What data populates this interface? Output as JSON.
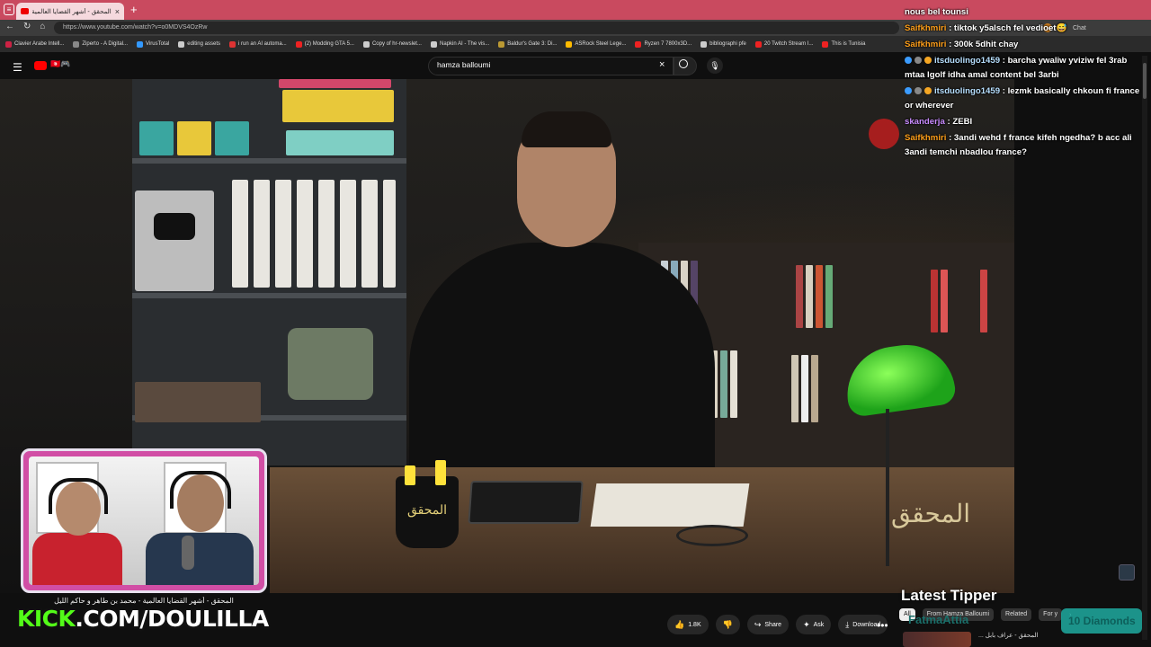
{
  "browser": {
    "tab_title": "المحقق - أشهر القضايا العالمية - مد",
    "tab_close": "×",
    "new_tab": "+",
    "url": "https://www.youtube.com/watch?v=o0MDVS4OzRw",
    "bookmarks": [
      {
        "label": "Clavier Arabe Intell...",
        "color": "#c24"
      },
      {
        "label": "Ziperto - A Digital...",
        "color": "#888"
      },
      {
        "label": "VirusTotal",
        "color": "#39f"
      },
      {
        "label": "editing assets",
        "color": "#ccc"
      },
      {
        "label": "i run an AI automa...",
        "color": "#d33"
      },
      {
        "label": "(2) Modding GTA 5...",
        "color": "#e22"
      },
      {
        "label": "Copy of hr-newslet...",
        "color": "#ccc"
      },
      {
        "label": "Napkin AI - The vis...",
        "color": "#ccc"
      },
      {
        "label": "Baldur's Gate 3: Di...",
        "color": "#b93"
      },
      {
        "label": "ASRock Steel Lege...",
        "color": "#fb0"
      },
      {
        "label": "Ryzen 7 7800x3D...",
        "color": "#e22"
      },
      {
        "label": "bibliographi pfe",
        "color": "#ccc"
      },
      {
        "label": "20 Twitch Stream I...",
        "color": "#e22"
      },
      {
        "label": "This is Tunisia",
        "color": "#e22"
      }
    ]
  },
  "youtube": {
    "search_query": "hamza balloumi",
    "search_clear": "×",
    "logo_extra": "🇹🇳🎮",
    "actions": [
      {
        "icon": "👍",
        "label": "1.8K",
        "name": "like-button"
      },
      {
        "icon": "👎",
        "label": "",
        "name": "dislike-button"
      },
      {
        "icon": "↪",
        "label": "Share",
        "name": "share-button"
      },
      {
        "icon": "✦",
        "label": "Ask",
        "name": "ask-button"
      },
      {
        "icon": "⤓",
        "label": "Download",
        "name": "download-button"
      }
    ],
    "more": "•••",
    "chips": [
      "All",
      "From Hamza Balloumi",
      "Related",
      "For y"
    ],
    "chips_next": "›",
    "related_title": "المحقق - عراف بابل ..."
  },
  "video": {
    "channel_logo_text": "المحقق",
    "cup_text": "المحقق"
  },
  "overlay": {
    "caption": "المحقق - أشهر القضايا العالمية - محمد بن طاهر و حاكم الليل",
    "kick_prefix": "KICK",
    "kick_rest": ".COM/DOULILLA",
    "latest_tipper_label": "Latest Tipper",
    "tipper_name": "FatmaAttia",
    "tipper_amount": "10 Diamonds"
  },
  "chat": {
    "header_label": "Chat",
    "messages": [
      {
        "user": "",
        "text": "nous bel tounsi",
        "badges": 0,
        "style": "user-saif"
      },
      {
        "user": "Saifkhmiri",
        "text": ": tiktok y5alsch fel vedioet😅",
        "badges": 0,
        "style": "user-saif"
      },
      {
        "user": "Saifkhmiri",
        "text": ": 300k 5dhit chay",
        "badges": 0,
        "style": "user-saif"
      },
      {
        "user": "itsduolingo1459",
        "text": ": barcha ywaliw yviziw fel 3rab mtaa lgolf idha amal content bel 3arbi",
        "badges": 3,
        "style": "user-duo"
      },
      {
        "user": "itsduolingo1459",
        "text": ": lezmk basically chkoun fi france or wherever",
        "badges": 3,
        "style": "user-duo"
      },
      {
        "user": "skanderja",
        "text": ": ZEBI",
        "badges": 0,
        "style": "user-sk"
      },
      {
        "user": "Saifkhmiri",
        "text": ": 3andi wehd f france kifeh ngedha? b acc ali 3andi temchi nbadlou france?",
        "badges": 0,
        "style": "user-saif"
      }
    ]
  },
  "colors": {
    "tab_bar": "#c94a5f",
    "webcam_border": "#d14ea5",
    "kick_green": "#53fc18",
    "lamp_green": "#1ea31a",
    "tipper_box": "#1eaaa0"
  }
}
